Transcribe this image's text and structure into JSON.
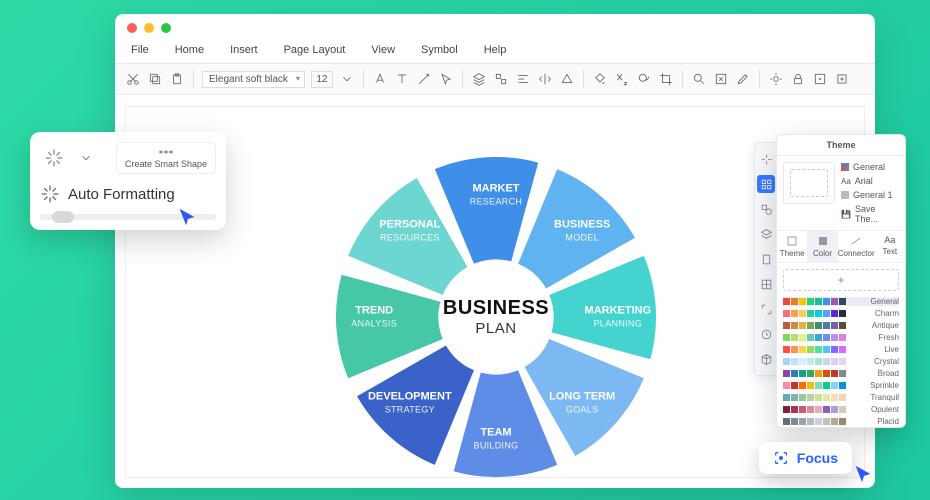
{
  "menus": {
    "file": "File",
    "home": "Home",
    "insert": "Insert",
    "page_layout": "Page Layout",
    "view": "View",
    "symbol": "Symbol",
    "help": "Help"
  },
  "toolbar": {
    "font": "Elegant soft black",
    "size": "12"
  },
  "diagram": {
    "center_top": "BUSINESS",
    "center_bottom": "PLAN",
    "segments": [
      {
        "title": "MARKET",
        "sub": "RESEARCH",
        "color": "#3f8fe8"
      },
      {
        "title": "BUSINESS",
        "sub": "MODEL",
        "color": "#5fb3f0"
      },
      {
        "title": "MARKETING",
        "sub": "PLANNING",
        "color": "#45d3cf"
      },
      {
        "title": "LONG TERM",
        "sub": "GOALS",
        "color": "#7cb8f2"
      },
      {
        "title": "TEAM",
        "sub": "BUILDING",
        "color": "#5d8de7"
      },
      {
        "title": "DEVELOPMENT",
        "sub": "STRATEGY",
        "color": "#3a62c8"
      },
      {
        "title": "TREND",
        "sub": "ANALYSIS",
        "color": "#46c7a6"
      },
      {
        "title": "PERSONAL",
        "sub": "RESOURCES",
        "color": "#6dd6d0"
      }
    ]
  },
  "float_panel": {
    "smart_shape": "Create Smart Shape",
    "auto_format": "Auto Formatting"
  },
  "theme": {
    "title": "Theme",
    "preview_items": [
      "General",
      "Arial",
      "General 1",
      "Save The..."
    ],
    "tabs": {
      "theme": "Theme",
      "color": "Color",
      "connector": "Connector",
      "text": "Text"
    },
    "palettes": [
      "General",
      "Charm",
      "Antique",
      "Fresh",
      "Live",
      "Crystal",
      "Broad",
      "Sprinkle",
      "Tranquil",
      "Opulent",
      "Placid"
    ]
  },
  "focus": {
    "label": "Focus"
  },
  "chart_data": {
    "type": "pie",
    "title": "BUSINESS PLAN",
    "categories": [
      "MARKET RESEARCH",
      "BUSINESS MODEL",
      "MARKETING PLANNING",
      "LONG TERM GOALS",
      "TEAM BUILDING",
      "DEVELOPMENT STRATEGY",
      "TREND ANALYSIS",
      "PERSONAL RESOURCES"
    ],
    "values": [
      1,
      1,
      1,
      1,
      1,
      1,
      1,
      1
    ],
    "colors": [
      "#3f8fe8",
      "#5fb3f0",
      "#45d3cf",
      "#7cb8f2",
      "#5d8de7",
      "#3a62c8",
      "#46c7a6",
      "#6dd6d0"
    ]
  },
  "palette_colors": [
    [
      "#e74c3c",
      "#e67e22",
      "#f1c40f",
      "#2ecc71",
      "#1abc9c",
      "#3498db",
      "#9b59b6",
      "#34495e"
    ],
    [
      "#ff6b81",
      "#ff9f43",
      "#feca57",
      "#1dd1a1",
      "#00d2d3",
      "#54a0ff",
      "#5f27cd",
      "#222f3e"
    ],
    [
      "#c0563b",
      "#d6893a",
      "#e0b24a",
      "#7aa653",
      "#3f8f6c",
      "#4f7aa3",
      "#7a5fa3",
      "#5c4a3e"
    ],
    [
      "#7ed957",
      "#b3e26b",
      "#e1f28a",
      "#64c9c3",
      "#3aa6d4",
      "#6c8ff0",
      "#b593f2",
      "#e37fe0"
    ],
    [
      "#ff4d4d",
      "#ff944d",
      "#ffd24d",
      "#8fe04d",
      "#4de0a0",
      "#4dc3ff",
      "#7b6bff",
      "#d66bff"
    ],
    [
      "#a3d5ff",
      "#bfe3ff",
      "#d4efff",
      "#bfeee6",
      "#a9e3d6",
      "#c8d6f2",
      "#dcd1f5",
      "#e9d3f2"
    ],
    [
      "#8e44ad",
      "#2980b9",
      "#16a085",
      "#27ae60",
      "#f39c12",
      "#d35400",
      "#c0392b",
      "#7f8c8d"
    ],
    [
      "#f78da7",
      "#cf2e2e",
      "#ff6900",
      "#fcb900",
      "#7bdcb5",
      "#00d084",
      "#8ed1fc",
      "#0693e3"
    ],
    [
      "#6aa8b4",
      "#7fb6a9",
      "#9bc6a0",
      "#b8d49a",
      "#d2df9c",
      "#e7e6a5",
      "#f0e0b3",
      "#eed4c0"
    ],
    [
      "#7b1f3a",
      "#a83254",
      "#c85a7a",
      "#de869f",
      "#e9a9bd",
      "#845ec2",
      "#b39cd0",
      "#d5cabd"
    ],
    [
      "#5e6e7a",
      "#7a8a95",
      "#96a4ad",
      "#b1bcc3",
      "#cbd3d8",
      "#c8c1b3",
      "#b2a88f",
      "#96886a"
    ]
  ]
}
